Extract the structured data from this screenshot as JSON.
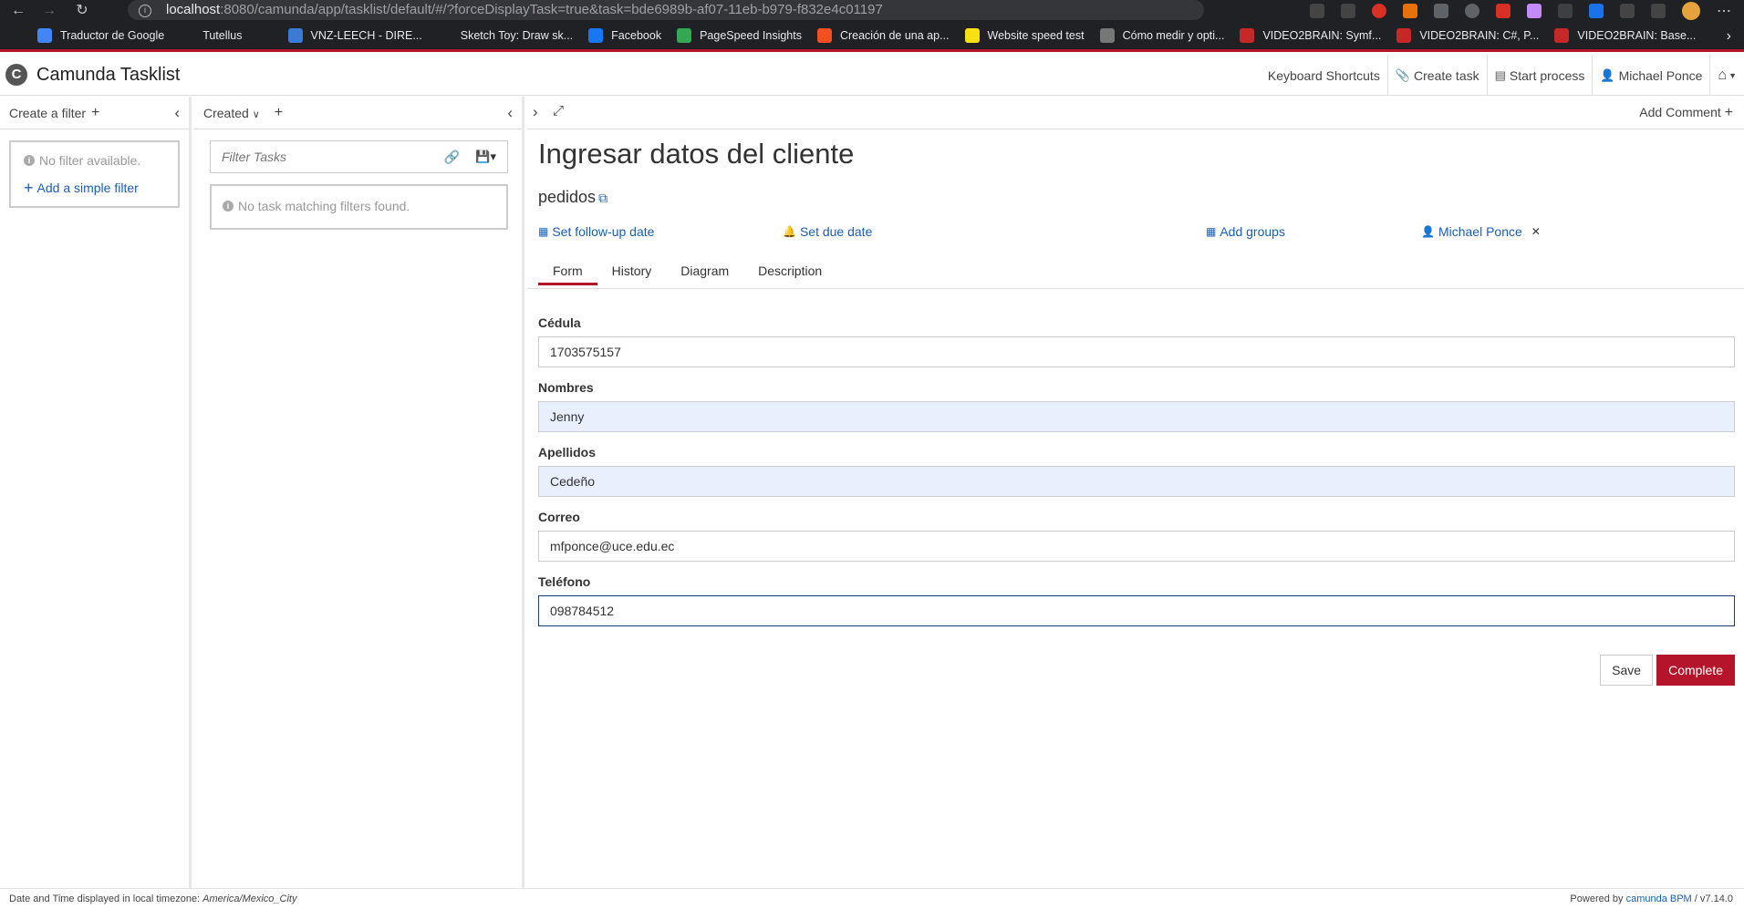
{
  "browser": {
    "url_host": "localhost",
    "url_rest": ":8080/camunda/app/tasklist/default/#/?forceDisplayTask=true&task=bde6989b-af07-11eb-b979-f832e4c01197",
    "bookmarks": [
      {
        "label": "",
        "icon": "github-icon",
        "color": "#202124"
      },
      {
        "label": "Traductor de Google",
        "icon": "google-translate-icon",
        "color": "#4285f4"
      },
      {
        "label": "Tutellus",
        "icon": "tutellus-icon",
        "color": "#202124"
      },
      {
        "label": "",
        "icon": "p-icon",
        "color": "#202124"
      },
      {
        "label": "VNZ-LEECH - DIRE...",
        "icon": "vnz-icon",
        "color": "#3a7bd5"
      },
      {
        "label": "Sketch Toy: Draw sk...",
        "icon": "sketch-icon",
        "color": "#202124"
      },
      {
        "label": "Facebook",
        "icon": "facebook-icon",
        "color": "#1877f2"
      },
      {
        "label": "PageSpeed Insights",
        "icon": "pagespeed-icon",
        "color": "#34a853"
      },
      {
        "label": "Creación de una ap...",
        "icon": "microsoft-icon",
        "color": "#f25022"
      },
      {
        "label": "Website speed test",
        "icon": "pingdom-icon",
        "color": "#fbe011"
      },
      {
        "label": "Cómo medir y opti...",
        "icon": "page-icon",
        "color": "#777777"
      },
      {
        "label": "VIDEO2BRAIN: Symf...",
        "icon": "video2brain-icon",
        "color": "#c62828"
      },
      {
        "label": "VIDEO2BRAIN: C#, P...",
        "icon": "video2brain-icon",
        "color": "#c62828"
      },
      {
        "label": "VIDEO2BRAIN: Base...",
        "icon": "video2brain-icon",
        "color": "#c62828"
      }
    ]
  },
  "header": {
    "title": "Camunda Tasklist",
    "keyboard_shortcuts": "Keyboard Shortcuts",
    "create_task": "Create task",
    "start_process": "Start process",
    "user": "Michael Ponce"
  },
  "filters": {
    "header": "Create a filter",
    "empty": "No filter available.",
    "add_simple": "Add a simple filter"
  },
  "list": {
    "sort_label": "Created",
    "filter_placeholder": "Filter Tasks",
    "empty": "No task matching filters found."
  },
  "detail": {
    "add_comment": "Add Comment",
    "title": "Ingresar datos del cliente",
    "process": "pedidos",
    "follow_up": "Set follow-up date",
    "due_date": "Set due date",
    "add_groups": "Add groups",
    "assignee": "Michael Ponce",
    "tabs": [
      "Form",
      "History",
      "Diagram",
      "Description"
    ],
    "form": {
      "cedula_label": "Cédula",
      "cedula_value": "1703575157",
      "nombres_label": "Nombres",
      "nombres_value": "Jenny",
      "apellidos_label": "Apellidos",
      "apellidos_value": "Cedeño",
      "correo_label": "Correo",
      "correo_value": "mfponce@uce.edu.ec",
      "telefono_label": "Teléfono",
      "telefono_value": "098784512"
    },
    "save": "Save",
    "complete": "Complete"
  },
  "footer": {
    "tz_prefix": "Date and Time displayed in local timezone: ",
    "tz": "America/Mexico_City",
    "powered_prefix": "Powered by ",
    "powered_link": "camunda BPM",
    "version": " / v7.14.0"
  },
  "colors": {
    "accent": "#b5152b",
    "link": "#1a5fb4"
  }
}
